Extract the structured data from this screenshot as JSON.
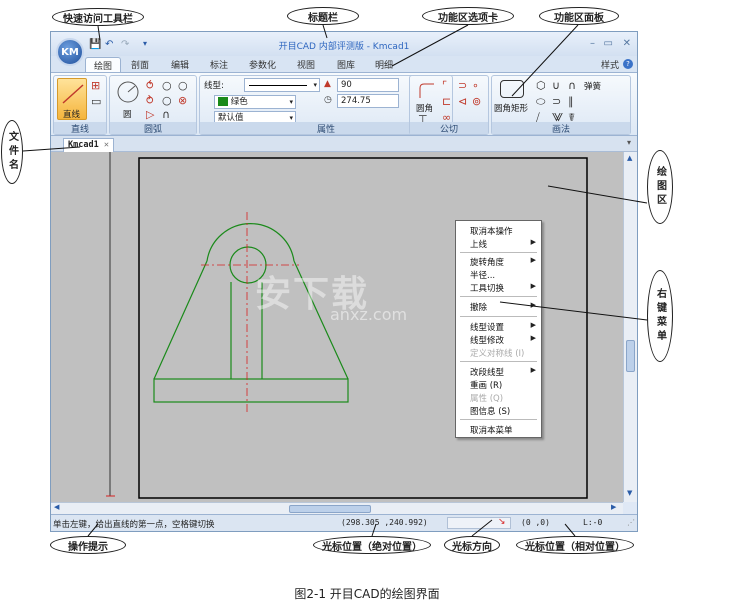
{
  "callouts": {
    "quick_access": "快速访问工具栏",
    "title_bar": "标题栏",
    "tab_bar": "功能区选项卡",
    "panel": "功能区面板",
    "file_name": "文件名",
    "draw_area": "绘图区",
    "context_menu": "右键菜单",
    "op_hint": "操作提示",
    "abs_pos": "光标位置（绝对位置）",
    "cursor_dir": "光标方向",
    "rel_pos": "光标位置（相对位置）"
  },
  "app": {
    "logo": "KM",
    "title": "开目CAD 内部评测版 - Kmcad1",
    "style_label": "样式"
  },
  "tabs": [
    {
      "label": "绘图"
    },
    {
      "label": "剖面"
    },
    {
      "label": "编辑"
    },
    {
      "label": "标注"
    },
    {
      "label": "参数化"
    },
    {
      "label": "视图"
    },
    {
      "label": "图库"
    },
    {
      "label": "明细"
    }
  ],
  "ribbon": {
    "line_group": {
      "label": "直线",
      "button": "直线"
    },
    "arc_group": {
      "label": "圆弧",
      "circle": "圆"
    },
    "props_group": {
      "label": "属性",
      "linetype_label": "线型:",
      "color_value": "绿色",
      "default_value": "默认值",
      "length_value": "90",
      "angle_value": "274.75"
    },
    "fillet_group": {
      "label": "公切",
      "fillet": "圆角"
    },
    "draw_group": {
      "label": "画法",
      "rect": "圆角矩形",
      "spring": "弹簧"
    }
  },
  "document_tab": "Kmcad1",
  "context_menu": {
    "items": [
      {
        "label": "取消本操作",
        "arrow": false,
        "disabled": false
      },
      {
        "label": "上线",
        "arrow": true,
        "disabled": false
      },
      {
        "label": "旋转角度",
        "arrow": true,
        "disabled": false
      },
      {
        "label": "半径...",
        "arrow": false,
        "disabled": false
      },
      {
        "label": "工具切换",
        "arrow": true,
        "disabled": false
      },
      {
        "label": "撤除",
        "arrow": true,
        "disabled": false
      },
      {
        "label": "线型设置",
        "arrow": true,
        "disabled": false
      },
      {
        "label": "线型修改",
        "arrow": true,
        "disabled": false
      },
      {
        "label": "定义对称线 (I)",
        "arrow": false,
        "disabled": true
      },
      {
        "label": "改段线型",
        "arrow": true,
        "disabled": false
      },
      {
        "label": "重画 (R)",
        "arrow": false,
        "disabled": false
      },
      {
        "label": "属性 (Q)",
        "arrow": false,
        "disabled": true
      },
      {
        "label": "图信息 (S)",
        "arrow": false,
        "disabled": false
      },
      {
        "label": "取消本菜单",
        "arrow": false,
        "disabled": false
      }
    ]
  },
  "status": {
    "hint": "单击左键，给出直线的第一点，空格键切换",
    "abs_coords": "(298.305 ,240.992)",
    "rel_coords": "(0 ,0)",
    "layer": "L:-0"
  },
  "watermark": {
    "text": "安下载",
    "url": "anxz.com"
  },
  "caption": "图2-1    开目CAD的绘图界面",
  "colors": {
    "drawing": "#1a8a1a",
    "centerline": "#d62020",
    "canvas": "#c0c0c0"
  }
}
